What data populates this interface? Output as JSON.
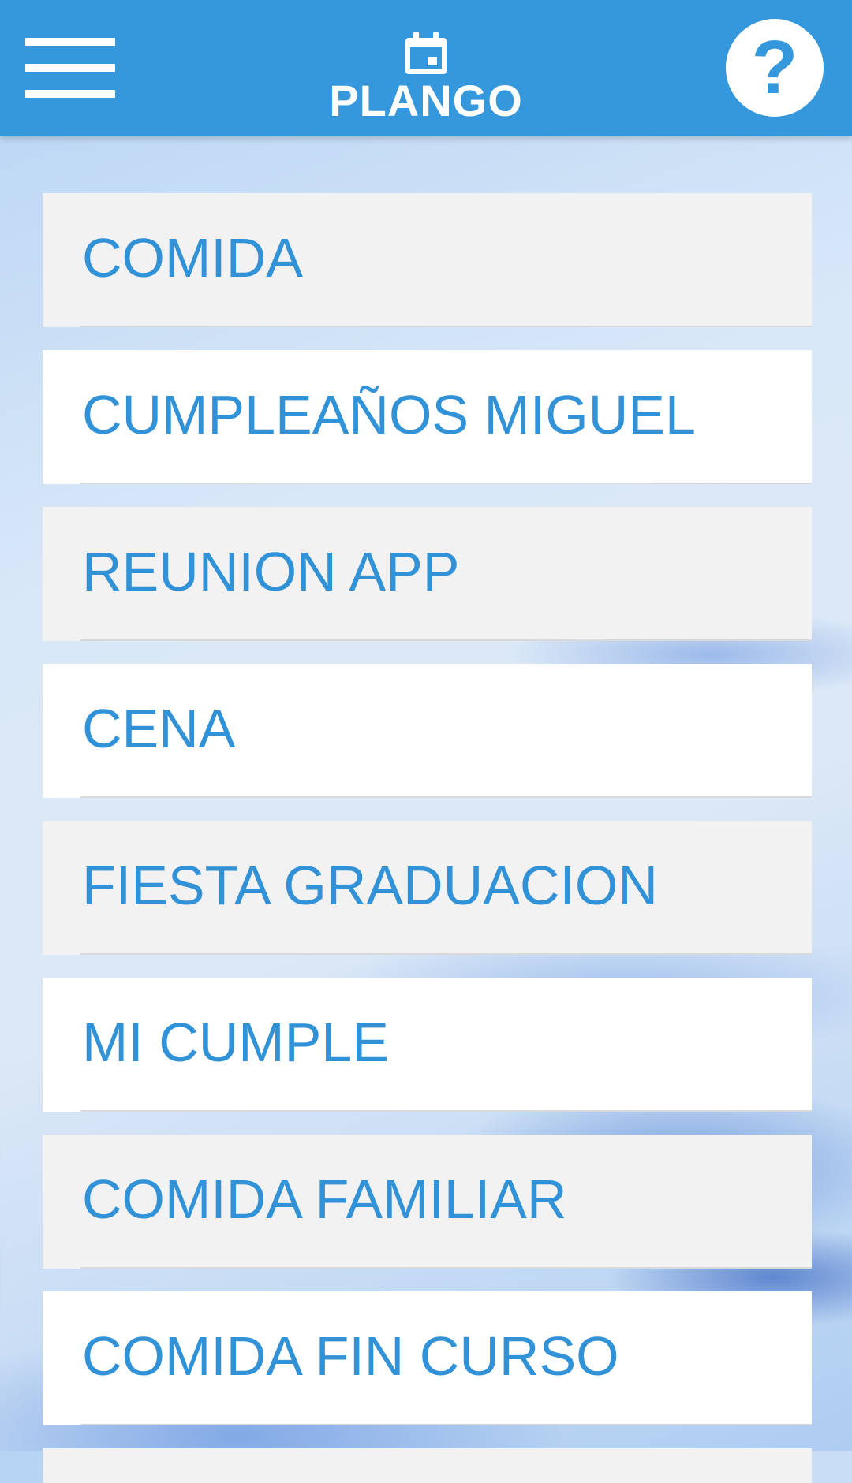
{
  "header": {
    "title": "PLANGO",
    "menu_icon": "hamburger-menu-icon",
    "brand_icon": "calendar-icon",
    "help_icon": "help-question-icon",
    "help_glyph": "?"
  },
  "colors": {
    "header_bg": "#3598dc",
    "item_text": "#3192d7",
    "item_bg_odd": "#f2f2f2",
    "item_bg_even": "#ffffff"
  },
  "events": [
    {
      "label": "COMIDA"
    },
    {
      "label": "CUMPLEAÑOS MIGUEL"
    },
    {
      "label": "REUNION APP"
    },
    {
      "label": "CENA"
    },
    {
      "label": "FIESTA GRADUACION"
    },
    {
      "label": "MI CUMPLE"
    },
    {
      "label": "COMIDA FAMILIAR"
    },
    {
      "label": "COMIDA FIN CURSO"
    }
  ]
}
